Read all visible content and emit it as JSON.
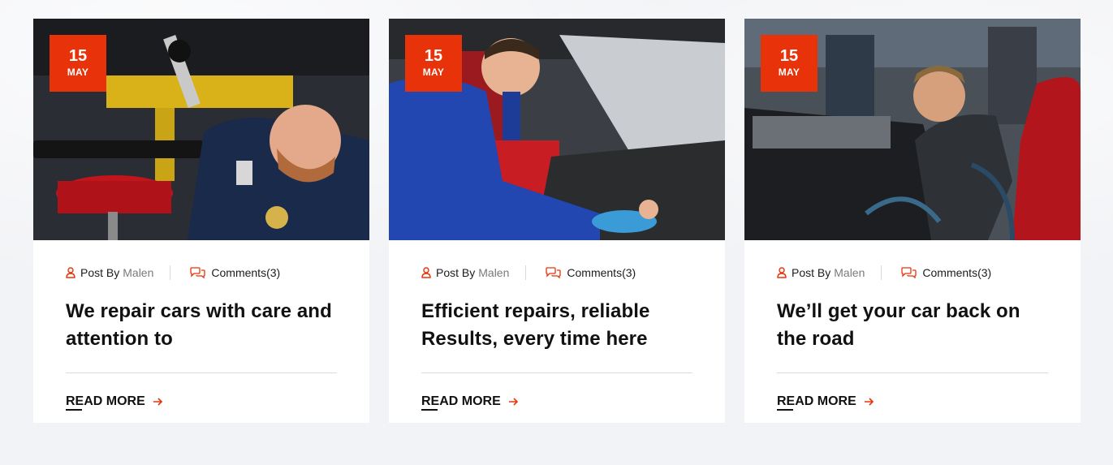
{
  "colors": {
    "accent": "#e8330a",
    "text": "#111111",
    "muted": "#7a7a7a"
  },
  "posts": [
    {
      "date": {
        "day": "15",
        "month": "MAY"
      },
      "author_label": "Post By",
      "author_name": "Malen",
      "comments": "Comments(3)",
      "title": "We repair cars with care and attention to",
      "read_more": "READ MORE"
    },
    {
      "date": {
        "day": "15",
        "month": "MAY"
      },
      "author_label": "Post By",
      "author_name": "Malen",
      "comments": "Comments(3)",
      "title": "Efficient repairs, reliable Results, every time here",
      "read_more": "READ MORE"
    },
    {
      "date": {
        "day": "15",
        "month": "MAY"
      },
      "author_label": "Post By",
      "author_name": "Malen",
      "comments": "Comments(3)",
      "title": "We’ll get your car back on the road",
      "read_more": "READ MORE"
    }
  ]
}
